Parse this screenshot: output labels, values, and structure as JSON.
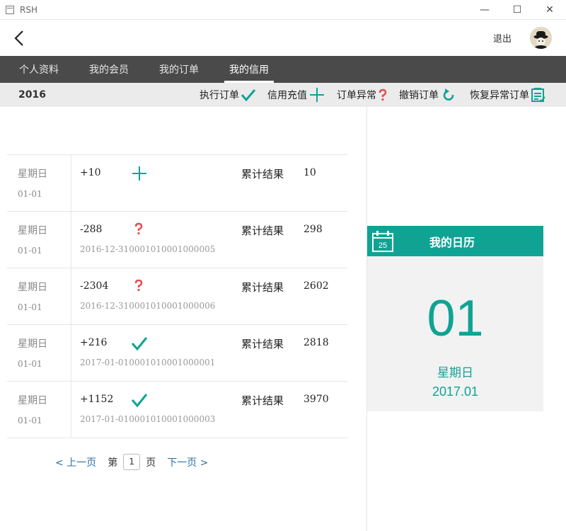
{
  "window": {
    "title": "RSH",
    "minimize": "—",
    "maximize": "☐",
    "close": "✕"
  },
  "header": {
    "logout": "退出"
  },
  "tabs": [
    {
      "label": "个人资料"
    },
    {
      "label": "我的会员"
    },
    {
      "label": "我的订单"
    },
    {
      "label": "我的信用"
    }
  ],
  "toolbar": {
    "year": "2016",
    "actions": [
      {
        "label": "执行订单",
        "icon": "check-icon"
      },
      {
        "label": "信用充值",
        "icon": "plus-icon"
      },
      {
        "label": "订单异常",
        "icon": "question-icon"
      },
      {
        "label": "撤销订单",
        "icon": "undo-icon"
      },
      {
        "label": "恢复异常订单",
        "icon": "list-edit-icon"
      }
    ]
  },
  "records": [
    {
      "weekday": "星期日",
      "date": "01-01",
      "amount": "+10",
      "status": "plus-icon",
      "order_id": "",
      "cum_label": "累计结果",
      "cum_value": "10"
    },
    {
      "weekday": "星期日",
      "date": "01-01",
      "amount": "-288",
      "status": "question-icon",
      "order_id": "2016-12-310001010001000005",
      "cum_label": "累计结果",
      "cum_value": "298"
    },
    {
      "weekday": "星期日",
      "date": "01-01",
      "amount": "-2304",
      "status": "question-icon",
      "order_id": "2016-12-310001010001000006",
      "cum_label": "累计结果",
      "cum_value": "2602"
    },
    {
      "weekday": "星期日",
      "date": "01-01",
      "amount": "+216",
      "status": "check-icon",
      "order_id": "2017-01-010001010001000001",
      "cum_label": "累计结果",
      "cum_value": "2818"
    },
    {
      "weekday": "星期日",
      "date": "01-01",
      "amount": "+1152",
      "status": "check-icon",
      "order_id": "2017-01-010001010001000003",
      "cum_label": "累计结果",
      "cum_value": "3970"
    }
  ],
  "pager": {
    "prev": "< 上一页",
    "page_prefix": "第",
    "page": "1",
    "page_suffix": "页",
    "next": "下一页 >"
  },
  "calendar": {
    "title": "我的日历",
    "icon_number": "25",
    "day": "01",
    "weekday": "星期日",
    "year_month": "2017.01"
  },
  "colors": {
    "accent": "#10a394",
    "warning": "#e74c4c",
    "tabbar": "#4a4a4a",
    "toolbar": "#ebebeb"
  }
}
